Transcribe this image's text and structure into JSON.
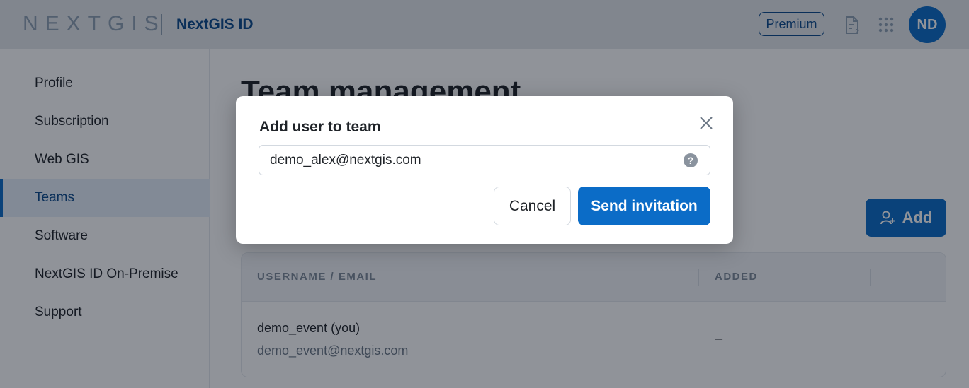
{
  "header": {
    "logo_text": "NEXTGIS",
    "product_name": "NextGIS ID",
    "premium_label": "Premium",
    "avatar_initials": "ND",
    "icons": [
      "document-help-icon",
      "apps-grid-icon"
    ]
  },
  "sidebar": {
    "items": [
      {
        "label": "Profile",
        "active": false
      },
      {
        "label": "Subscription",
        "active": false
      },
      {
        "label": "Web GIS",
        "active": false
      },
      {
        "label": "Teams",
        "active": true
      },
      {
        "label": "Software",
        "active": false
      },
      {
        "label": "NextGIS ID On-Premise",
        "active": false
      },
      {
        "label": "Support",
        "active": false
      }
    ]
  },
  "main": {
    "title": "Team management",
    "add_label": "Add",
    "table": {
      "columns": [
        "USERNAME / EMAIL",
        "ADDED"
      ],
      "rows": [
        {
          "name": "demo_event (you)",
          "email": "demo_event@nextgis.com",
          "added": "–"
        }
      ]
    }
  },
  "modal": {
    "title": "Add user to team",
    "email_value": "demo_alex@nextgis.com",
    "cancel_label": "Cancel",
    "send_label": "Send invitation"
  },
  "colors": {
    "accent": "#0b6cc7",
    "brand_dark": "#0b4a8a",
    "overlay": "rgba(8,16,28,0.45)"
  }
}
